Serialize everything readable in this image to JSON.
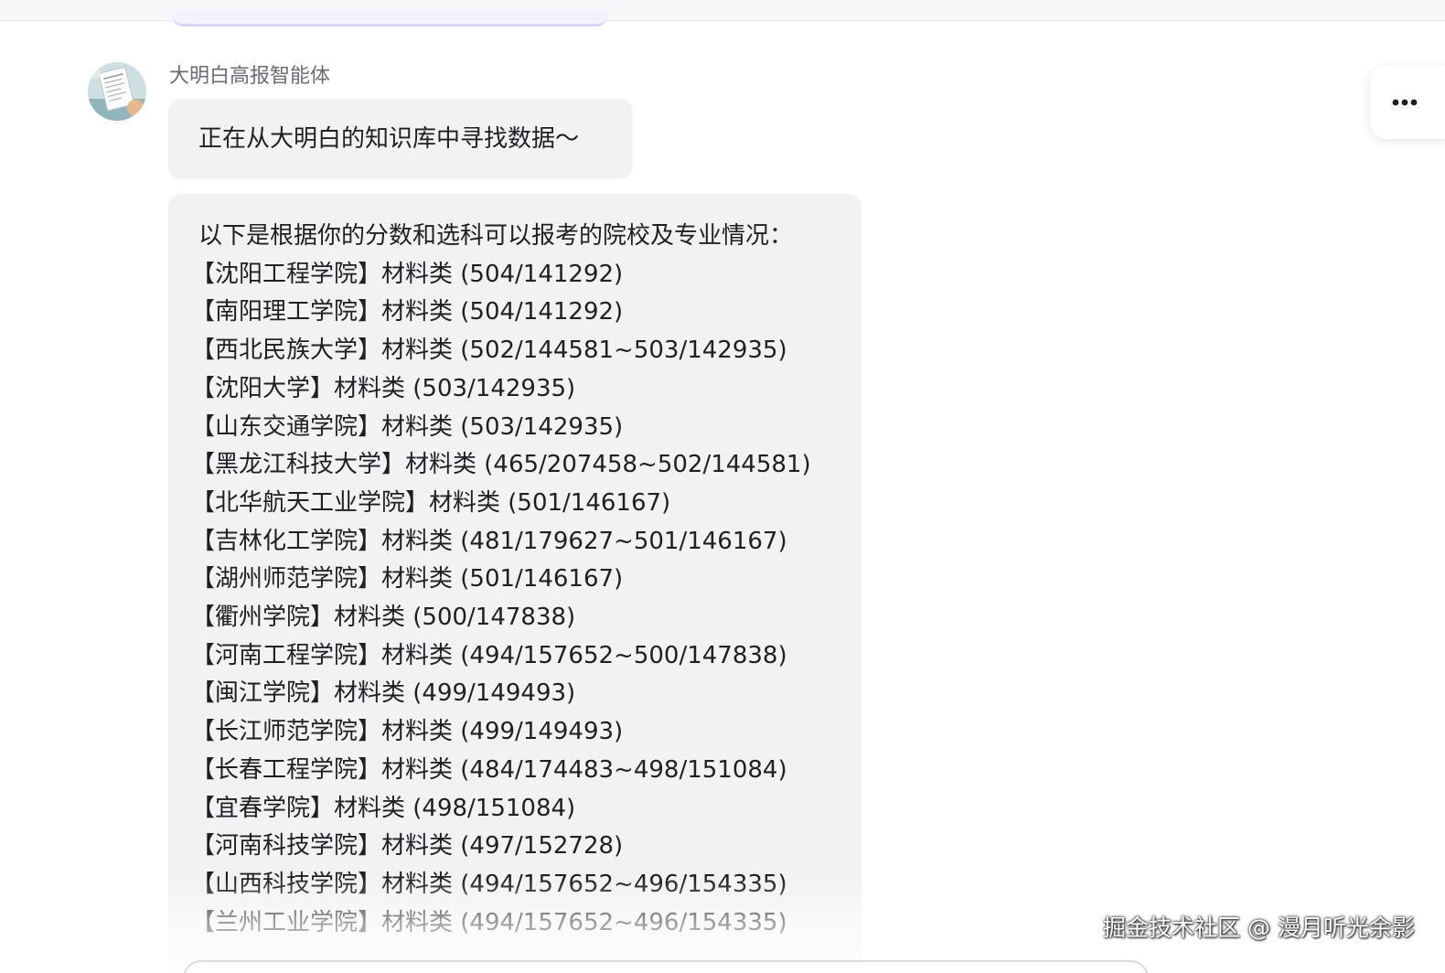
{
  "chat": {
    "agent_name": "大明白高报智能体",
    "status_message": "正在从大明白的知识库中寻找数据～",
    "result_intro": "以下是根据你的分数和选科可以报考的院校及专业情况：",
    "results": [
      "【沈阳工程学院】材料类 (504/141292)",
      "【南阳理工学院】材料类 (504/141292)",
      "【西北民族大学】材料类 (502/144581~503/142935)",
      "【沈阳大学】材料类 (503/142935)",
      "【山东交通学院】材料类 (503/142935)",
      "【黑龙江科技大学】材料类 (465/207458~502/144581)",
      "【北华航天工业学院】材料类 (501/146167)",
      "【吉林化工学院】材料类 (481/179627~501/146167)",
      "【湖州师范学院】材料类 (501/146167)",
      "【衢州学院】材料类 (500/147838)",
      "【河南工程学院】材料类 (494/157652~500/147838)",
      "【闽江学院】材料类 (499/149493)",
      "【长江师范学院】材料类 (499/149493)",
      "【长春工程学院】材料类 (484/174483~498/151084)",
      "【宜春学院】材料类 (498/151084)",
      "【河南科技学院】材料类 (497/152728)",
      "【山西科技学院】材料类 (494/157652~496/154335)",
      "【兰州工业学院】材料类 (494/157652~496/154335)"
    ]
  },
  "more_button_icon": "ellipsis-icon",
  "watermark": "掘金技术社区 @ 漫月听光余影",
  "colors": {
    "bubble_bg": "#f2f2f4",
    "text": "#1f1f24",
    "agent_name": "#6b6b73"
  }
}
